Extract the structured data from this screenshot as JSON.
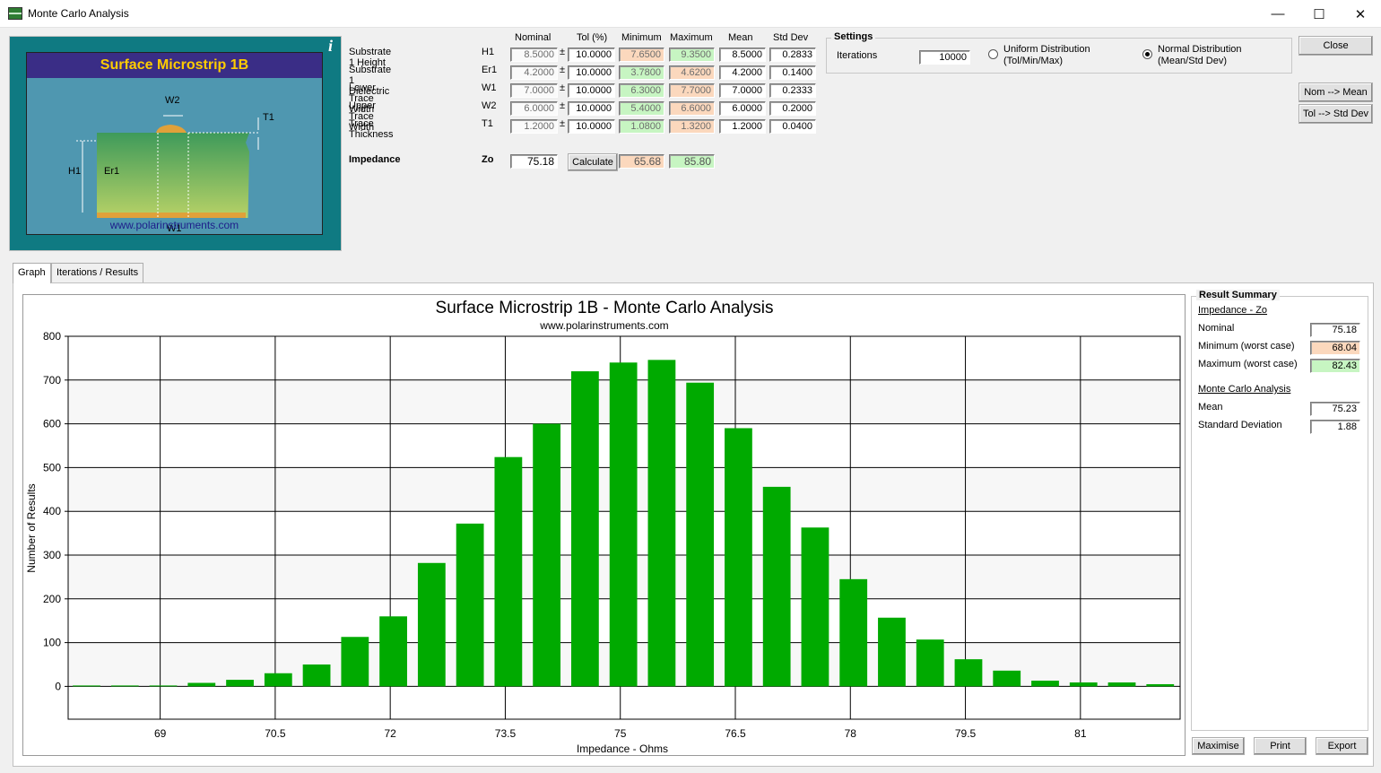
{
  "window": {
    "title": "Monte Carlo Analysis",
    "controls": {
      "minimize": "—",
      "maximize": "☐",
      "close": "✕"
    }
  },
  "picture": {
    "title": "Surface Microstrip 1B",
    "url": "www.polarinstruments.com",
    "info_icon": "i",
    "labels": {
      "w2": "W2",
      "t1": "T1",
      "h1": "H1",
      "er1": "Er1",
      "w1": "W1"
    }
  },
  "grid": {
    "headers": [
      "Nominal",
      "Tol (%)",
      "Minimum",
      "Maximum",
      "Mean",
      "Std Dev"
    ],
    "plus_minus": "±",
    "rows": [
      {
        "label": "Substrate 1 Height",
        "sym": "H1",
        "nominal": "8.5000",
        "tol": "10.0000",
        "min": "7.6500",
        "max": "9.3500",
        "mean": "8.5000",
        "std": "0.2833",
        "min_color": "peach",
        "max_color": "mint"
      },
      {
        "label": "Substrate 1 Dielectric",
        "sym": "Er1",
        "nominal": "4.2000",
        "tol": "10.0000",
        "min": "3.7800",
        "max": "4.6200",
        "mean": "4.2000",
        "std": "0.1400",
        "min_color": "mint",
        "max_color": "peach"
      },
      {
        "label": "Lower Trace Width",
        "sym": "W1",
        "nominal": "7.0000",
        "tol": "10.0000",
        "min": "6.3000",
        "max": "7.7000",
        "mean": "7.0000",
        "std": "0.2333",
        "min_color": "mint",
        "max_color": "peach"
      },
      {
        "label": "Upper Trace Width",
        "sym": "W2",
        "nominal": "6.0000",
        "tol": "10.0000",
        "min": "5.4000",
        "max": "6.6000",
        "mean": "6.0000",
        "std": "0.2000",
        "min_color": "mint",
        "max_color": "peach"
      },
      {
        "label": "Trace Thickness",
        "sym": "T1",
        "nominal": "1.2000",
        "tol": "10.0000",
        "min": "1.0800",
        "max": "1.3200",
        "mean": "1.2000",
        "std": "0.0400",
        "min_color": "mint",
        "max_color": "peach"
      }
    ],
    "impedance": {
      "label": "Impedance",
      "sym": "Zo",
      "nominal": "75.18",
      "calculate": "Calculate",
      "min": "65.68",
      "max": "85.80"
    }
  },
  "settings": {
    "title": "Settings",
    "iterations_label": "Iterations",
    "iterations": "10000",
    "uniform_line1": "Uniform Distribution",
    "uniform_line2": "(Tol/Min/Max)",
    "normal_line1": "Normal Distribution",
    "normal_line2": "(Mean/Std Dev)",
    "selected": "normal"
  },
  "buttons": {
    "close": "Close",
    "nom_mean": "Nom --> Mean",
    "tol_std": "Tol --> Std Dev",
    "maximise": "Maximise",
    "print": "Print",
    "export": "Export"
  },
  "tabs": [
    "Graph",
    "Iterations / Results"
  ],
  "summary": {
    "title": "Result Summary",
    "impedance_heading": "Impedance - Zo",
    "nominal_label": "Nominal",
    "nominal": "75.18",
    "min_label": "Minimum (worst case)",
    "min": "68.04",
    "max_label": "Maximum (worst case)",
    "max": "82.43",
    "mc_heading": "Monte Carlo Analysis",
    "mean_label": "Mean",
    "mean": "75.23",
    "std_label": "Standard Deviation",
    "std": "1.88"
  },
  "colors": {
    "bar": "#00aa00",
    "peach": "#fbd8bd",
    "mint": "#c7f5c2",
    "panel_teal": "#0f7a82"
  },
  "chart_data": {
    "type": "bar",
    "title": "Surface Microstrip 1B - Monte Carlo Analysis",
    "subtitle": "www.polarinstruments.com",
    "xlabel": "Impedance - Ohms",
    "ylabel": "Number of Results",
    "ylim": [
      -75,
      800
    ],
    "xlim": [
      67.8,
      82.3
    ],
    "yticks": [
      0,
      100,
      200,
      300,
      400,
      500,
      600,
      700,
      800
    ],
    "xticks": [
      69,
      70.5,
      72,
      73.5,
      75,
      76.5,
      78,
      79.5,
      81
    ],
    "xtick_labels": [
      "69",
      "70.5",
      "72",
      "73.5",
      "75",
      "76.5",
      "78",
      "79.5",
      "81"
    ],
    "grid": true,
    "bin_width": 0.5,
    "x": [
      68.04,
      68.54,
      69.04,
      69.54,
      70.04,
      70.54,
      71.04,
      71.54,
      72.04,
      72.54,
      73.04,
      73.54,
      74.04,
      74.54,
      75.04,
      75.54,
      76.04,
      76.54,
      77.04,
      77.54,
      78.04,
      78.54,
      79.04,
      79.54,
      80.04,
      80.54,
      81.04,
      81.54,
      82.04
    ],
    "values": [
      2,
      0,
      2,
      8,
      15,
      30,
      50,
      113,
      160,
      282,
      372,
      524,
      600,
      720,
      740,
      746,
      694,
      590,
      456,
      363,
      245,
      157,
      107,
      62,
      36,
      13,
      9,
      9,
      5
    ]
  }
}
